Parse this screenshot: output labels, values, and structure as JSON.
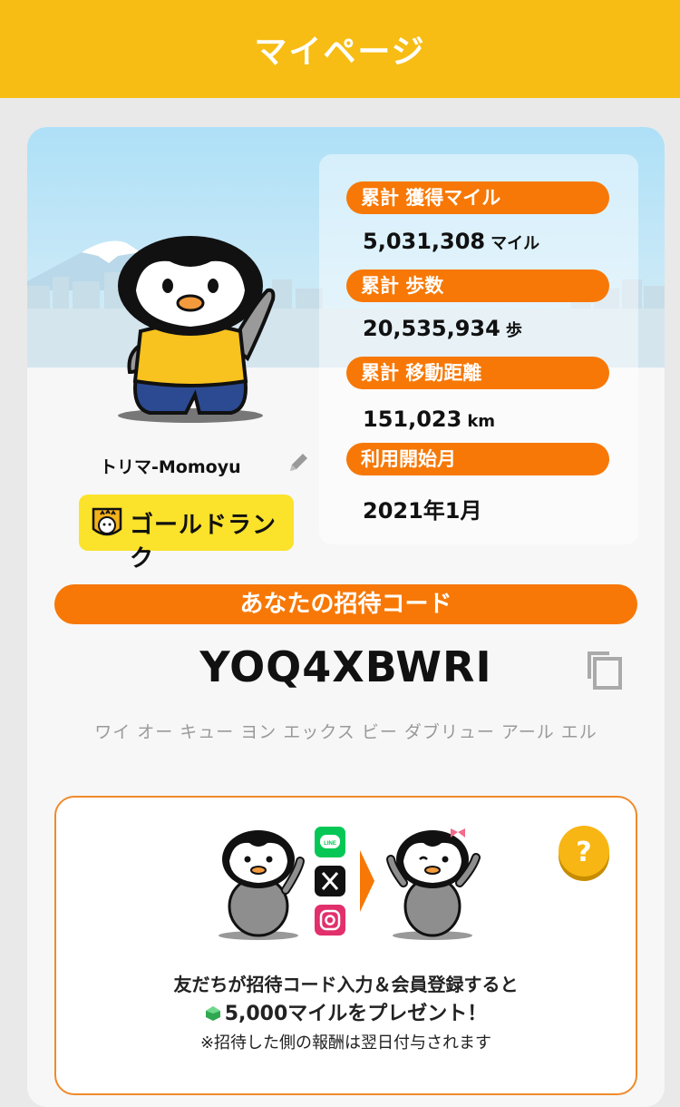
{
  "header": {
    "title": "マイページ"
  },
  "profile": {
    "nickname": "トリマ-Momoyu",
    "rank": "ゴールドランク"
  },
  "stats": [
    {
      "label": "累計 獲得マイル",
      "value": "5,031,308",
      "unit": "マイル"
    },
    {
      "label": "累計 歩数",
      "value": "20,535,934",
      "unit": "歩"
    },
    {
      "label": "累計 移動距離",
      "value": "151,023",
      "unit": "km"
    },
    {
      "label": "利用開始月",
      "value": "2021年1月",
      "unit": ""
    }
  ],
  "invite": {
    "heading": "あなたの招待コード",
    "code": "YOQ4XBWRI",
    "reading": "ワイ オー キュー ヨン エックス ビー ダブリュー アール エル"
  },
  "promo": {
    "line1": "友だちが招待コード入力＆会員登録すると",
    "line2": "5,000マイルをプレゼント！",
    "note": "※招待した側の報酬は翌日付与されます",
    "help_label": "?",
    "share_icons": [
      "line-icon",
      "x-icon",
      "instagram-icon"
    ]
  },
  "colors": {
    "header": "#f7bd14",
    "accent_orange": "#f77806",
    "rank_yellow": "#fbe22b"
  }
}
